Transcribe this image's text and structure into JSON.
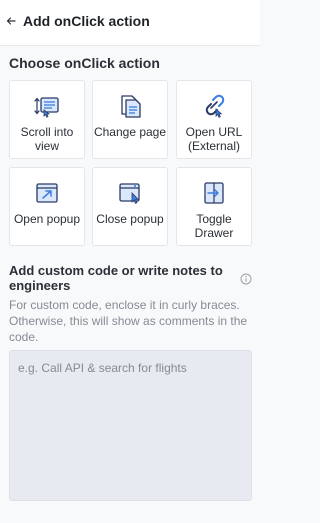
{
  "header": {
    "title": "Add onClick action",
    "back_icon": "arrow-left-icon"
  },
  "actions_section": {
    "title": "Choose onClick action",
    "actions": [
      {
        "label": "Scroll into view",
        "icon": "scroll-into-view-icon"
      },
      {
        "label": "Change page",
        "icon": "change-page-icon"
      },
      {
        "label": "Open URL (External)",
        "icon": "external-link-icon"
      },
      {
        "label": "Open popup",
        "icon": "open-popup-icon"
      },
      {
        "label": "Close popup",
        "icon": "close-popup-icon"
      },
      {
        "label": "Toggle Drawer",
        "icon": "toggle-drawer-icon"
      }
    ]
  },
  "notes_section": {
    "title": "Add custom code or write notes to engineers",
    "info_icon": "info-icon",
    "hint": "For custom code, enclose it in curly braces. Otherwise, this will show as comments in the code.",
    "placeholder": "e.g. Call API & search for flights",
    "value": ""
  },
  "colors": {
    "accent": "#3b7fe0",
    "accent_dark": "#2b3a67",
    "background": "#f8f9fb",
    "textarea_bg": "#e8eaf1"
  }
}
